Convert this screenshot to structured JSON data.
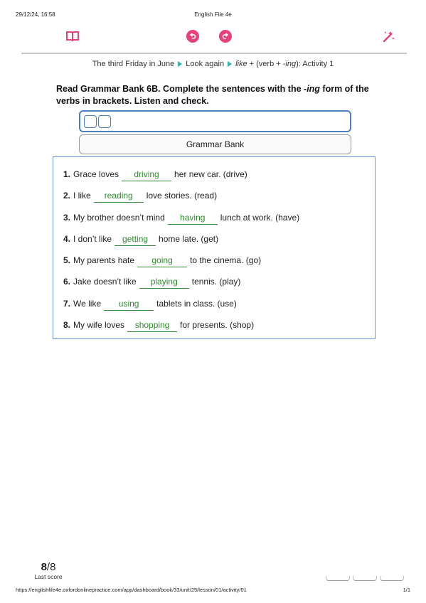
{
  "print_header": {
    "datetime": "29/12/24, 16:58",
    "title": "English File 4e"
  },
  "toolbar": {
    "book_icon": "book-icon",
    "undo_icon": "undo-icon",
    "redo_icon": "redo-icon",
    "tools_icon": "magic-wand-icon",
    "accent_color": "#e8407a"
  },
  "breadcrumb": {
    "item1": "The third Friday in June",
    "item2": "Look again",
    "item3_italic": "like",
    "item3_mid": " + (verb + ",
    "item3_italic2": "-ing",
    "item3_end": "): Activity 1"
  },
  "instruction": {
    "part1": "Read Grammar Bank 6B. Complete the sentences with the ",
    "italic": "-ing",
    "part2": " form of the verbs in brackets. Listen and check."
  },
  "grammar_bank_button": "Grammar Bank",
  "exercise": {
    "items": [
      {
        "num": "1.",
        "before": "Grace loves",
        "answer": "driving",
        "after": "her new car. (drive)"
      },
      {
        "num": "2.",
        "before": "I like",
        "answer": "reading",
        "after": "love stories. (read)"
      },
      {
        "num": "3.",
        "before": "My brother doesn’t mind",
        "answer": "having",
        "after": "lunch at work. (have)"
      },
      {
        "num": "4.",
        "before": "I don’t like",
        "answer": "getting",
        "after": "home late. (get)"
      },
      {
        "num": "5.",
        "before": "My parents hate",
        "answer": "going",
        "after": "to the cinema. (go)"
      },
      {
        "num": "6.",
        "before": "Jake doesn’t like",
        "answer": "playing",
        "after": "tennis. (play)"
      },
      {
        "num": "7.",
        "before": "We like",
        "answer": "using",
        "after": "tablets in class. (use)"
      },
      {
        "num": "8.",
        "before": "My wife loves",
        "answer": "shopping",
        "after": "for presents. (shop)"
      }
    ],
    "answer_color": "#2e8b2e"
  },
  "score": {
    "value": "8",
    "total": "/8",
    "label": "Last score"
  },
  "footer": {
    "url": "https://englishfile4e.oxfordonlinepractice.com/app/dashboard/book/33/unit/25/lesson/01/activity/01",
    "page": "1/1"
  }
}
